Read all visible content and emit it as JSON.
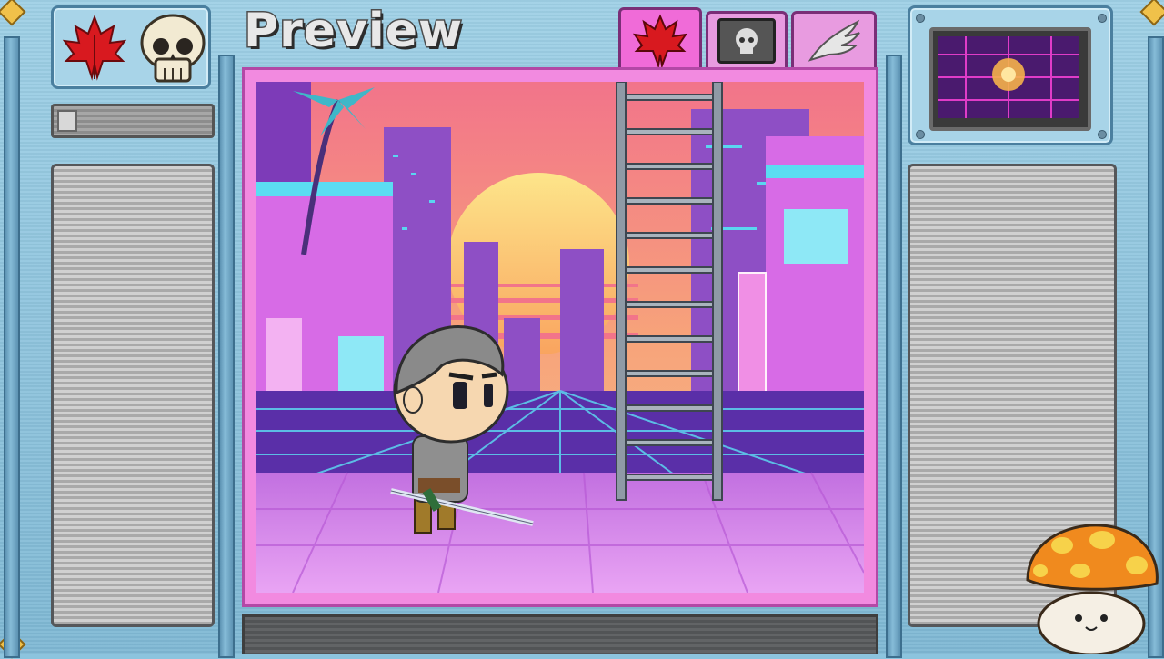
{
  "window": {
    "title": "Preview"
  },
  "left_panel": {
    "icons": [
      "maple-leaf-icon",
      "skull-icon"
    ],
    "name_bar_value": ""
  },
  "tabs": [
    {
      "icon": "maple-leaf-icon",
      "active": true
    },
    {
      "icon": "skull-icon",
      "active": false
    },
    {
      "icon": "wing-icon",
      "active": false
    }
  ],
  "preview": {
    "scene": "vaporwave-city",
    "character": "chibi-swordsman"
  },
  "colors": {
    "accent": "#f06bd8",
    "frame": "#8cc4de",
    "stage_border": "#b348a6"
  }
}
